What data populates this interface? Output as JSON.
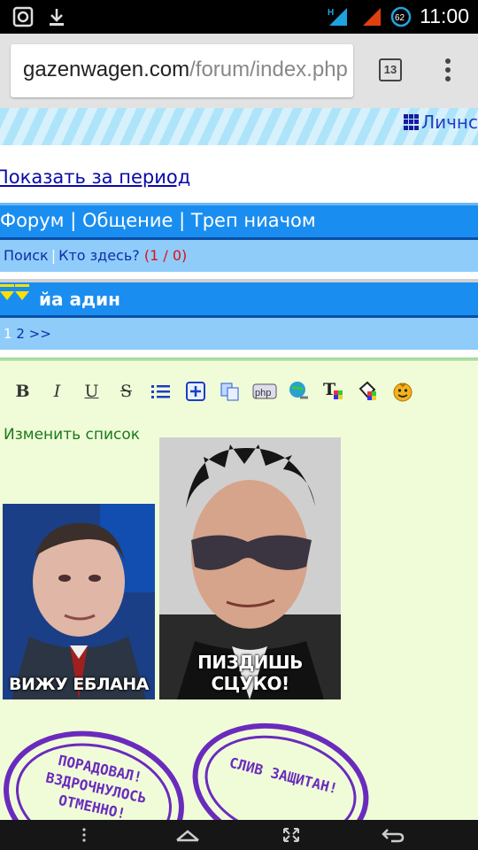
{
  "status_bar": {
    "time": "11:00",
    "battery": "62",
    "network_type": "H",
    "icons": [
      "vpn-icon",
      "download-icon",
      "signal-icon",
      "battery-icon"
    ]
  },
  "browser": {
    "url_host": "gazenwagen.com",
    "url_path": "/forum/index.php",
    "tab_count": "13"
  },
  "forum": {
    "lichno_label": "Личнс",
    "period_link": "Показать за период",
    "breadcrumb": {
      "forum": "Форум",
      "separator": " | ",
      "section": "Общение",
      "subsection": "Треп ниачом"
    },
    "subnav": {
      "search": "Поиск",
      "who_here": "Кто здесь?",
      "count": "(1 / 0)"
    },
    "topic_title": "йа адин",
    "pagination": {
      "current": "1",
      "next_page": "2",
      "next": ">>"
    }
  },
  "editor": {
    "toolbar": [
      "B",
      "I",
      "U",
      "S",
      "list",
      "insert",
      "copy",
      "php",
      "link",
      "font",
      "color",
      "smile"
    ],
    "edit_list_label": "Изменить список",
    "images": [
      {
        "caption": "ВИЖУ ЕБЛАНА"
      },
      {
        "caption": "ПИЗДИШЬ СЦУКО!"
      }
    ],
    "stamps": [
      {
        "lines": [
          "ПОРАДОВАЛ!",
          "ВЗДРОЧНУЛОСЬ",
          "ОТМЕННО!"
        ]
      },
      {
        "lines": [
          "СЛИВ ЗАЩИТАН!"
        ]
      }
    ]
  },
  "colors": {
    "header_blue": "#1a8ef0",
    "sub_blue": "#8fccfa",
    "post_bg": "#f0fcd8",
    "stamp_purple": "#6a2bbd"
  }
}
